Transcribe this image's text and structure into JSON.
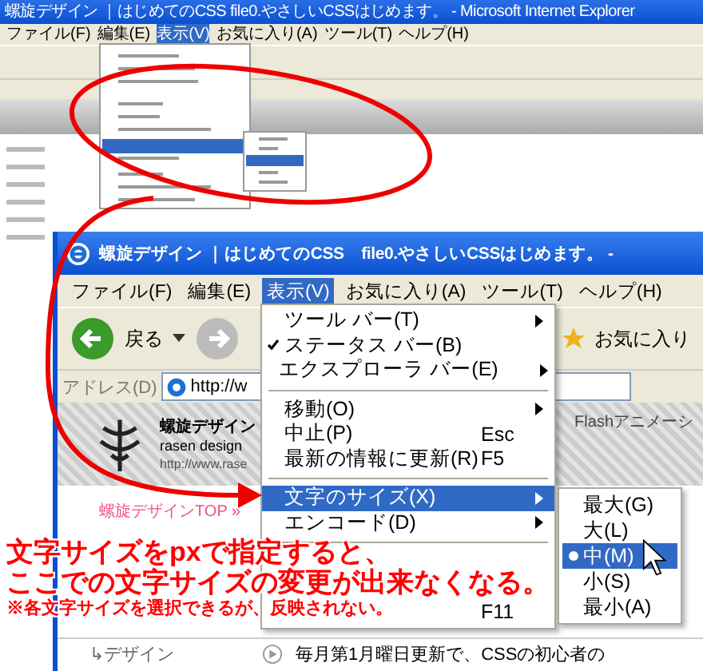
{
  "background_window": {
    "title": "螺旋デザイン ｜はじめてのCSS file0.やさしいCSSはじめます。 - Microsoft Internet Explorer",
    "menu": [
      {
        "label": "ファイル(F)",
        "selected": false
      },
      {
        "label": "編集(E)",
        "selected": false
      },
      {
        "label": "表示(V)",
        "selected": true
      },
      {
        "label": "お気に入り(A)",
        "selected": false
      },
      {
        "label": "ツール(T)",
        "selected": false
      },
      {
        "label": "ヘルプ(H)",
        "selected": false
      }
    ]
  },
  "window": {
    "title": "螺旋デザイン ｜はじめてのCSS　file0.やさしいCSSはじめます。 -",
    "menu": [
      {
        "label": "ファイル(F)",
        "selected": false
      },
      {
        "label": "編集(E)",
        "selected": false
      },
      {
        "label": "表示(V)",
        "selected": true
      },
      {
        "label": "お気に入り(A)",
        "selected": false
      },
      {
        "label": "ツール(T)",
        "selected": false
      },
      {
        "label": "ヘルプ(H)",
        "selected": false
      }
    ],
    "back_label": "戻る",
    "favorites_label": "お気に入り",
    "address_label": "アドレス(D)",
    "address_value": "http://w",
    "logo_title": "螺旋デザイン",
    "logo_sub": "rasen design",
    "logo_url": "http://www.rase",
    "nav_text": "Flashアニメーシ",
    "breadcrumb": "螺旋デザインTOP »",
    "sidebar_item": "↳デザイン",
    "body_text": "毎月第1月曜日更新で、CSSの初心者の"
  },
  "view_menu": [
    {
      "kind": "item",
      "label": "ツール バー(T)",
      "checked": false,
      "submenu": true,
      "selected": false
    },
    {
      "kind": "item",
      "label": "ステータス バー(B)",
      "checked": true,
      "submenu": false,
      "selected": false
    },
    {
      "kind": "item",
      "label": "エクスプローラ バー(E)",
      "checked": false,
      "submenu": true,
      "selected": false
    },
    {
      "kind": "separator"
    },
    {
      "kind": "item",
      "label": "移動(O)",
      "checked": false,
      "submenu": true,
      "selected": false
    },
    {
      "kind": "item",
      "label": "中止(P)",
      "shortcut": "Esc",
      "checked": false,
      "submenu": false,
      "selected": false
    },
    {
      "kind": "item",
      "label": "最新の情報に更新(R)",
      "shortcut": "F5",
      "checked": false,
      "submenu": false,
      "selected": false
    },
    {
      "kind": "separator"
    },
    {
      "kind": "item",
      "label": "文字のサイズ(X)",
      "checked": false,
      "submenu": true,
      "selected": true
    },
    {
      "kind": "item",
      "label": "エンコード(D)",
      "checked": false,
      "submenu": true,
      "selected": false
    },
    {
      "kind": "separator"
    },
    {
      "kind": "covered"
    },
    {
      "kind": "covered"
    },
    {
      "kind": "item",
      "shortcut": "F11",
      "checked": false,
      "submenu": false,
      "selected": false
    }
  ],
  "text_size_menu": [
    {
      "label": "最大(G)",
      "selected": false
    },
    {
      "label": "大(L)",
      "selected": false
    },
    {
      "label": "中(M)",
      "selected": true
    },
    {
      "label": "小(S)",
      "selected": false
    },
    {
      "label": "最小(A)",
      "selected": false
    }
  ],
  "annotation": {
    "lines": [
      "文字サイズをpxで指定すると、",
      "ここでの文字サイズの変更が出来なくなる。"
    ],
    "note": "※各文字サイズを選択できるが、反映されない。"
  }
}
